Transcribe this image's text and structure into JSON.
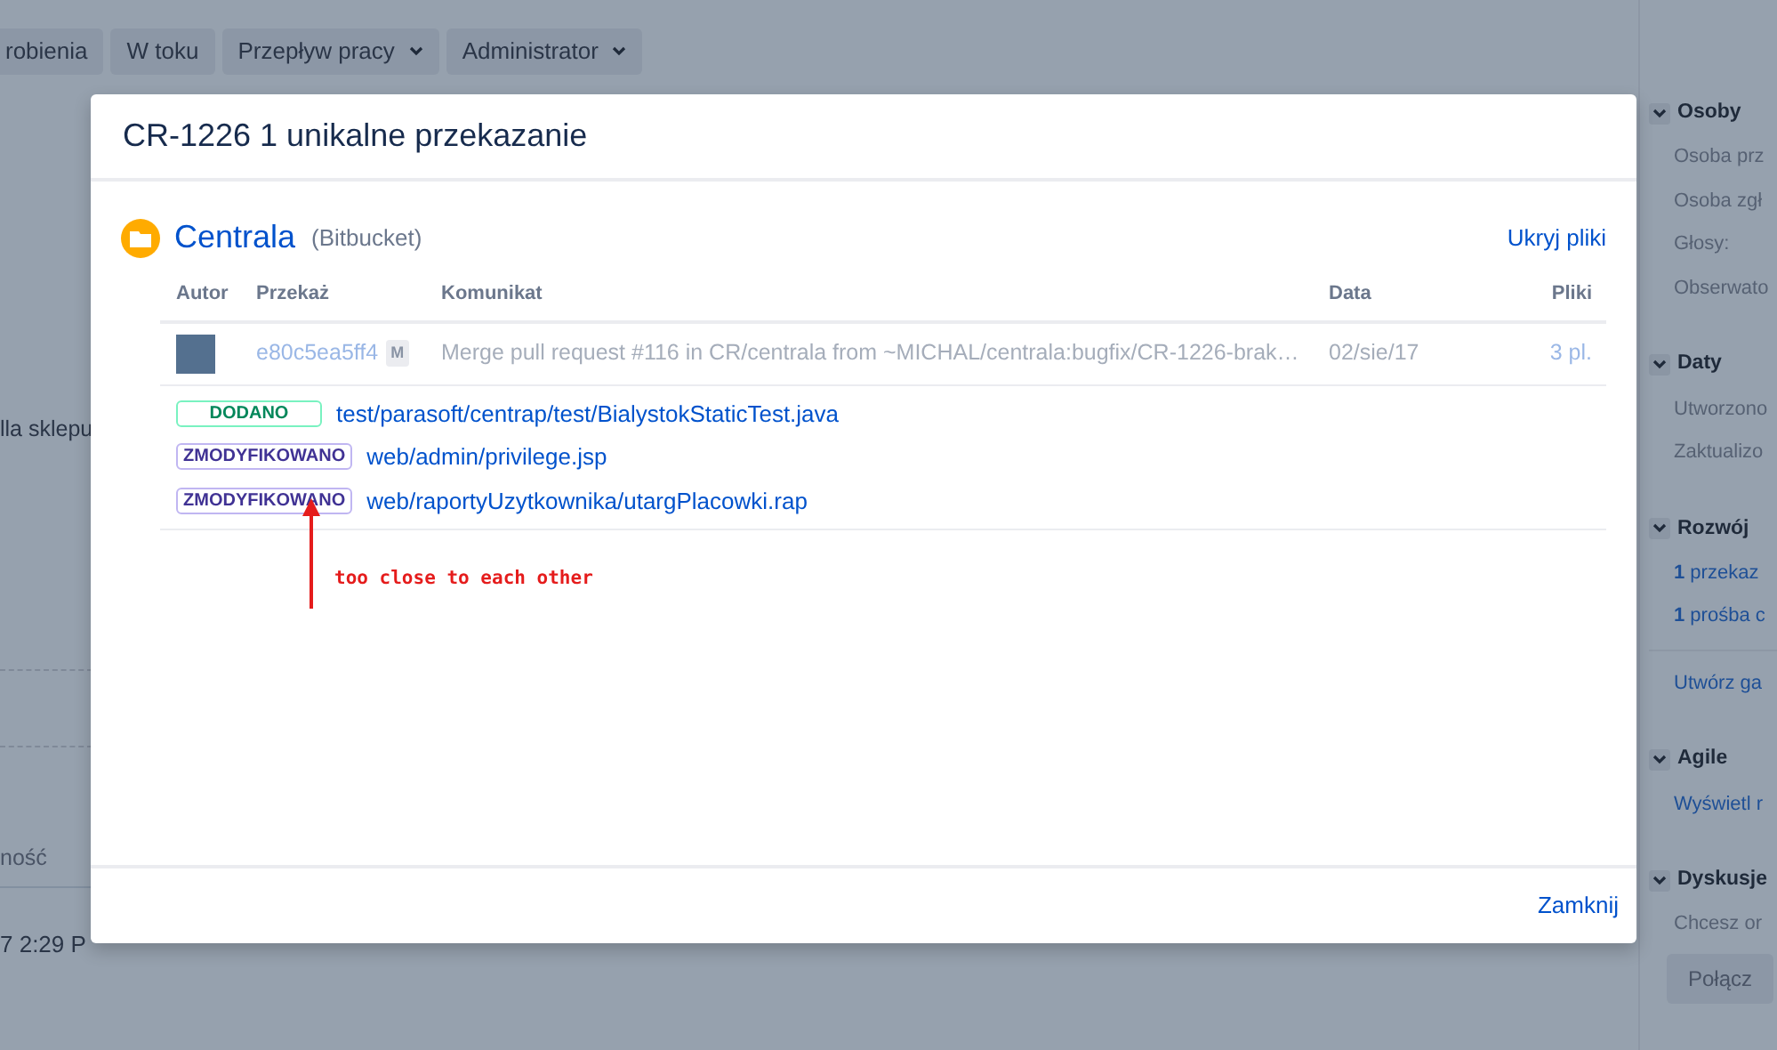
{
  "top_buttons": [
    {
      "label": "robienia",
      "dropdown": false
    },
    {
      "label": "W toku",
      "dropdown": false
    },
    {
      "label": "Przepływ pracy",
      "dropdown": true
    },
    {
      "label": "Administrator",
      "dropdown": true
    }
  ],
  "page_left": {
    "text_1": "lla sklepu",
    "column_label": "ność",
    "time": "7 2:29 P"
  },
  "sidebar": {
    "sections": [
      {
        "title": "Osoby",
        "items": [
          {
            "kind": "label",
            "text": "Osoba prz"
          },
          {
            "kind": "label",
            "text": "Osoba zgł"
          },
          {
            "kind": "label",
            "text": "Głosy:"
          },
          {
            "kind": "label",
            "text": "Obserwato"
          }
        ]
      },
      {
        "title": "Daty",
        "items": [
          {
            "kind": "label",
            "text": "Utworzono"
          },
          {
            "kind": "label",
            "text": "Zaktualizo"
          }
        ]
      },
      {
        "title": "Rozwój",
        "items": [
          {
            "kind": "link",
            "text": "**1** przekaz"
          },
          {
            "kind": "link",
            "text": "**1** prośba c"
          },
          {
            "kind": "divided_link",
            "text": "Utwórz ga"
          }
        ]
      },
      {
        "title": "Agile",
        "items": [
          {
            "kind": "link",
            "text": "Wyświetl r"
          }
        ]
      },
      {
        "title": "Dyskusje",
        "items": [
          {
            "kind": "label",
            "text": "Chcesz or"
          },
          {
            "kind": "button",
            "text": "Połącz"
          }
        ]
      }
    ]
  },
  "dialog": {
    "title": "CR-1226 1 unikalne przekazanie",
    "repository": {
      "name": "Centrala",
      "source": "(Bitbucket)"
    },
    "hide_files_link": "Ukryj pliki",
    "columns": [
      "Autor",
      "Przekaż",
      "Komunikat",
      "Data",
      "Pliki"
    ],
    "commits": [
      {
        "hash": "e80c5ea5ff4",
        "merge_badge": "M",
        "message": "Merge pull request #116 in CR/centrala from ~MICHAL/centrala:bugfix/CR-1226-brak…",
        "date": "02/sie/17",
        "files": "3 pl."
      }
    ],
    "files": [
      {
        "kind": "added",
        "status": "DODANO",
        "path": "test/parasoft/centrap/test/BialystokStaticTest.java"
      },
      {
        "kind": "modified",
        "status": "ZMODYFIKOWANO",
        "path": "web/admin/privilege.jsp"
      },
      {
        "kind": "modified",
        "status": "ZMODYFIKOWANO",
        "path": "web/raportyUzytkownika/utargPlacowki.rap"
      }
    ],
    "close_button": "Zamknij"
  },
  "annotation": {
    "text": "too close to each other"
  }
}
